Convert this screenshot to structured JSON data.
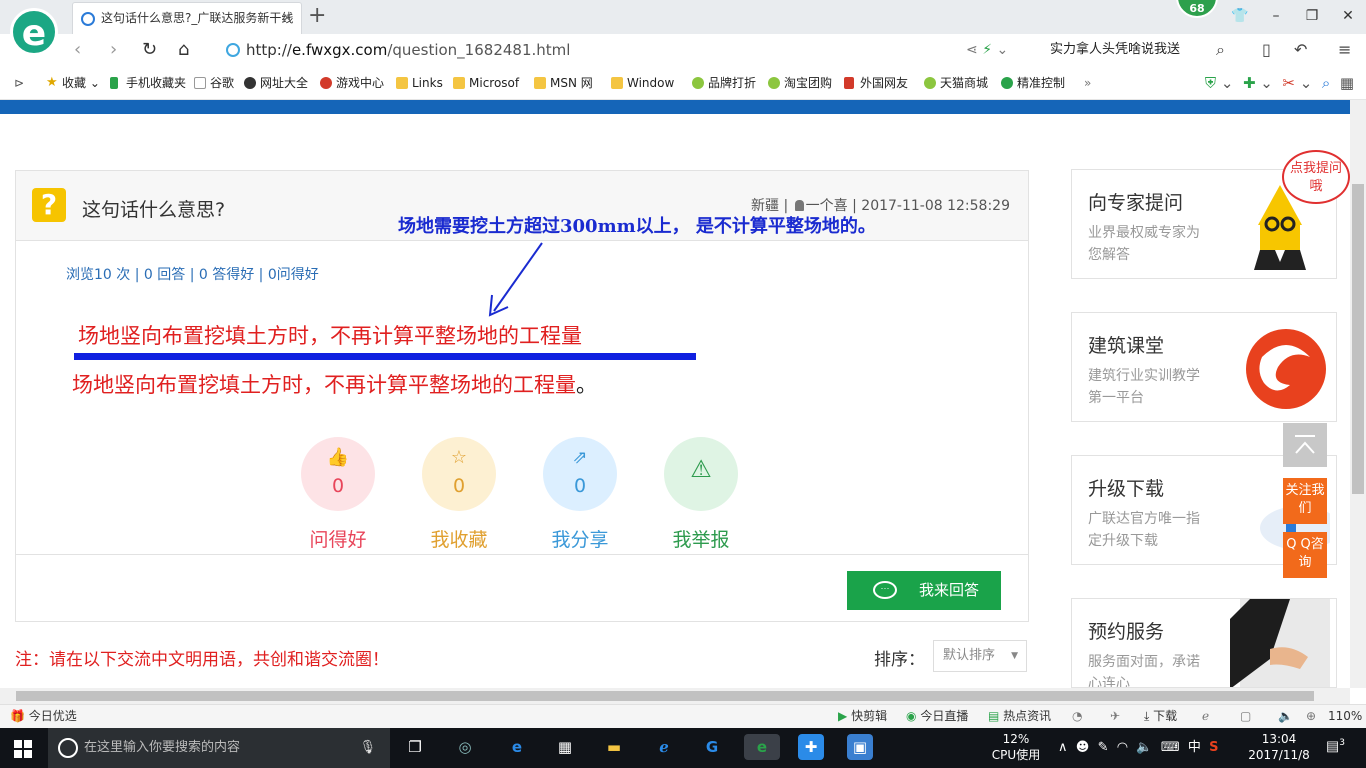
{
  "browser": {
    "tab_title": "这句话什么意思?_广联达服务新干线",
    "tab_close": "×",
    "new_tab": "+",
    "badge": "68",
    "url_prefix": "http://",
    "url_host": "e.fwxgx.com",
    "url_path": "/question_1682481.html",
    "hot_search": "实力拿人头凭啥说我送",
    "zoom": "110%"
  },
  "bookmarks": [
    {
      "label": "收藏",
      "icon": "star-icon"
    },
    {
      "label": "手机收藏夹",
      "icon": "phone-icon"
    },
    {
      "label": "谷歌",
      "icon": "doc-icon"
    },
    {
      "label": "网址大全",
      "icon": "globe-icon"
    },
    {
      "label": "游戏中心",
      "icon": "game-icon"
    },
    {
      "label": "Links",
      "icon": "folder-icon"
    },
    {
      "label": "Microsof",
      "icon": "folder-icon"
    },
    {
      "label": "MSN 网",
      "icon": "folder-icon"
    },
    {
      "label": "Window",
      "icon": "folder-icon"
    },
    {
      "label": "品牌打折",
      "icon": "leaf-icon"
    },
    {
      "label": "淘宝团购",
      "icon": "leaf-icon"
    },
    {
      "label": "外国网友",
      "icon": "bookmark-icon"
    },
    {
      "label": "天猫商城",
      "icon": "leaf-icon"
    },
    {
      "label": "精准控制",
      "icon": "chat-icon"
    }
  ],
  "question": {
    "title": "这句话什么意思?",
    "region": "新疆",
    "author": "一个喜",
    "time": "2017-11-08 12:58:29",
    "stats": "浏览10 次 | 0 回答 | 0 答得好 | 0问得好",
    "annotation": "场地需要挖土方超过300mm以上，  是不计算平整场地的。",
    "content_line1": "场地竖向布置挖填土方时，不再计算平整场地的工程量",
    "content_line2": "场地竖向布置挖填土方时，不再计算平整场地的工程量",
    "content_line2_end": "。"
  },
  "actions": [
    {
      "label": "问得好",
      "count": "0",
      "icon": "thumb-up-icon",
      "color": "#e8455a",
      "bg": "#fde3e6"
    },
    {
      "label": "我收藏",
      "count": "0",
      "icon": "star-icon",
      "color": "#e0a030",
      "bg": "#fdf0d2"
    },
    {
      "label": "我分享",
      "count": "0",
      "icon": "share-icon",
      "color": "#3a98d8",
      "bg": "#dcefff"
    },
    {
      "label": "我举报",
      "count": "0",
      "icon": "warning-icon",
      "color": "#2e9b4e",
      "bg": "#dff4e4"
    }
  ],
  "answer_button": "我来回答",
  "note": "注：请在以下交流中文明用语，共创和谐交流圈！",
  "sort": {
    "label": "排序：",
    "value": "默认排序"
  },
  "sidebar": [
    {
      "title": "向专家提问",
      "desc": "业界最权威专家为您解答"
    },
    {
      "title": "建筑课堂",
      "desc": "建筑行业实训教学第一平台"
    },
    {
      "title": "升级下载",
      "desc": "广联达官方唯一指定升级下载"
    },
    {
      "title": "预约服务",
      "desc": "服务面对面，承诺心连心"
    }
  ],
  "speech_bubble": "点我提问哦",
  "float": {
    "follow": "关注我们",
    "qq": "Q Q咨询"
  },
  "statusbar": {
    "left": "今日优选",
    "kuaijian": "快剪辑",
    "live": "今日直播",
    "news": "热点资讯",
    "download": "下载"
  },
  "taskbar": {
    "search_placeholder": "在这里输入你要搜索的内容",
    "cpu_percent": "12%",
    "cpu_label": "CPU使用",
    "ime": "中",
    "time": "13:04",
    "date": "2017/11/8",
    "notifications": "3"
  },
  "colors": {
    "brand_blue": "#1565b8",
    "answer_red": "#e02020",
    "annotation_blue": "#1a2bd0",
    "green_button": "#1aa34a",
    "orange_float": "#f26a1b"
  }
}
